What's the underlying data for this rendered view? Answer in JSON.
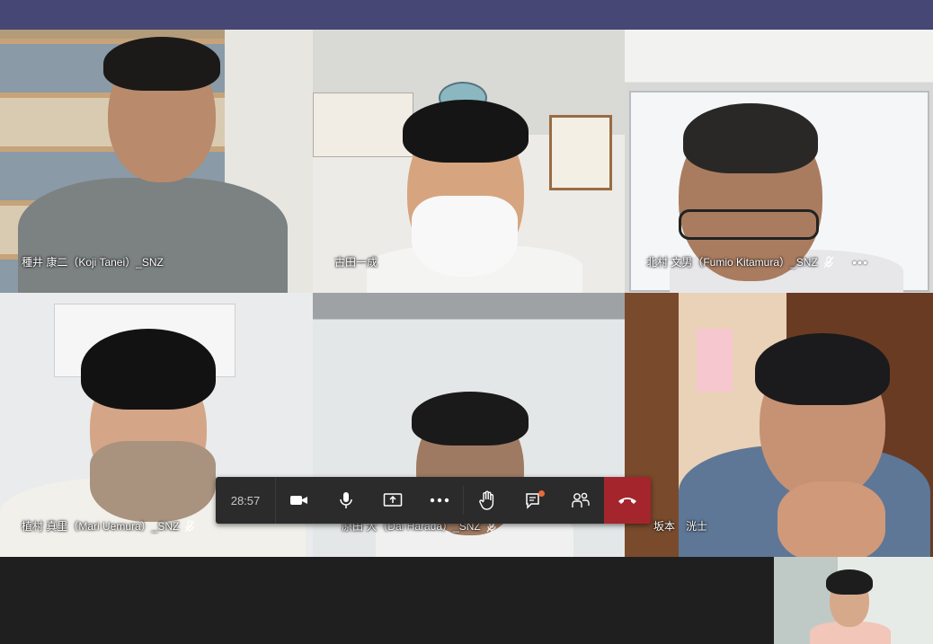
{
  "window": {
    "topbar_color": "#464775"
  },
  "participants": [
    {
      "name": "種井 康二（Koji Tanei）_SNZ",
      "muted": false
    },
    {
      "name": "古田一成",
      "muted": false
    },
    {
      "name": "北村 文男（Fumio Kitamura）_SNZ",
      "muted": true,
      "more": "•••"
    },
    {
      "name": "植村 真里（Mari Uemura）_SNZ",
      "muted": true
    },
    {
      "name": "原田 大（Dai Harada）_SNZ",
      "muted": true
    },
    {
      "name": "坂本　洸士",
      "muted": false
    }
  ],
  "toolbar": {
    "timer": "28:57",
    "buttons": [
      "camera-icon",
      "microphone-icon",
      "share-screen-icon",
      "more-actions-icon",
      "raise-hand-icon",
      "chat-icon",
      "participants-icon",
      "hang-up-icon"
    ],
    "end_color": "#a4262c"
  }
}
